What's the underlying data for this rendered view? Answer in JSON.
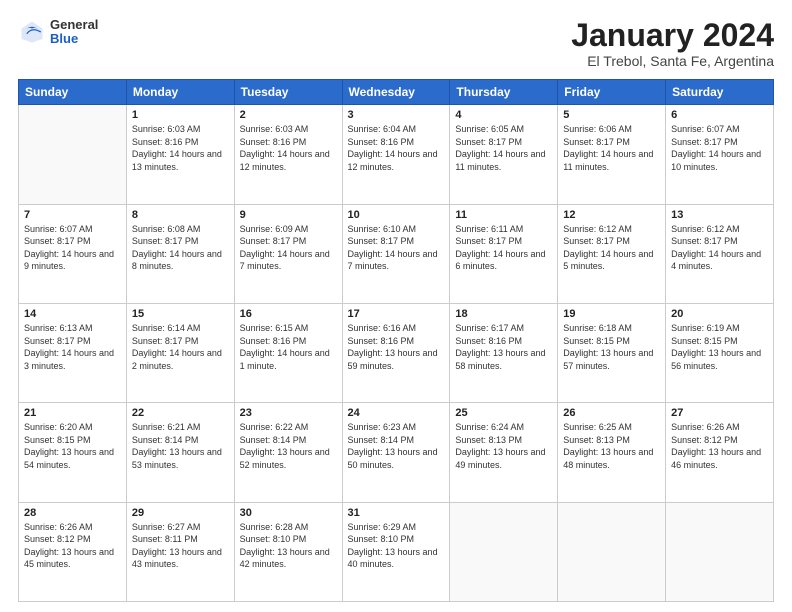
{
  "logo": {
    "general": "General",
    "blue": "Blue"
  },
  "title": "January 2024",
  "subtitle": "El Trebol, Santa Fe, Argentina",
  "header_days": [
    "Sunday",
    "Monday",
    "Tuesday",
    "Wednesday",
    "Thursday",
    "Friday",
    "Saturday"
  ],
  "weeks": [
    [
      {
        "day": "",
        "sunrise": "",
        "sunset": "",
        "daylight": ""
      },
      {
        "day": "1",
        "sunrise": "Sunrise: 6:03 AM",
        "sunset": "Sunset: 8:16 PM",
        "daylight": "Daylight: 14 hours and 13 minutes."
      },
      {
        "day": "2",
        "sunrise": "Sunrise: 6:03 AM",
        "sunset": "Sunset: 8:16 PM",
        "daylight": "Daylight: 14 hours and 12 minutes."
      },
      {
        "day": "3",
        "sunrise": "Sunrise: 6:04 AM",
        "sunset": "Sunset: 8:16 PM",
        "daylight": "Daylight: 14 hours and 12 minutes."
      },
      {
        "day": "4",
        "sunrise": "Sunrise: 6:05 AM",
        "sunset": "Sunset: 8:17 PM",
        "daylight": "Daylight: 14 hours and 11 minutes."
      },
      {
        "day": "5",
        "sunrise": "Sunrise: 6:06 AM",
        "sunset": "Sunset: 8:17 PM",
        "daylight": "Daylight: 14 hours and 11 minutes."
      },
      {
        "day": "6",
        "sunrise": "Sunrise: 6:07 AM",
        "sunset": "Sunset: 8:17 PM",
        "daylight": "Daylight: 14 hours and 10 minutes."
      }
    ],
    [
      {
        "day": "7",
        "sunrise": "Sunrise: 6:07 AM",
        "sunset": "Sunset: 8:17 PM",
        "daylight": "Daylight: 14 hours and 9 minutes."
      },
      {
        "day": "8",
        "sunrise": "Sunrise: 6:08 AM",
        "sunset": "Sunset: 8:17 PM",
        "daylight": "Daylight: 14 hours and 8 minutes."
      },
      {
        "day": "9",
        "sunrise": "Sunrise: 6:09 AM",
        "sunset": "Sunset: 8:17 PM",
        "daylight": "Daylight: 14 hours and 7 minutes."
      },
      {
        "day": "10",
        "sunrise": "Sunrise: 6:10 AM",
        "sunset": "Sunset: 8:17 PM",
        "daylight": "Daylight: 14 hours and 7 minutes."
      },
      {
        "day": "11",
        "sunrise": "Sunrise: 6:11 AM",
        "sunset": "Sunset: 8:17 PM",
        "daylight": "Daylight: 14 hours and 6 minutes."
      },
      {
        "day": "12",
        "sunrise": "Sunrise: 6:12 AM",
        "sunset": "Sunset: 8:17 PM",
        "daylight": "Daylight: 14 hours and 5 minutes."
      },
      {
        "day": "13",
        "sunrise": "Sunrise: 6:12 AM",
        "sunset": "Sunset: 8:17 PM",
        "daylight": "Daylight: 14 hours and 4 minutes."
      }
    ],
    [
      {
        "day": "14",
        "sunrise": "Sunrise: 6:13 AM",
        "sunset": "Sunset: 8:17 PM",
        "daylight": "Daylight: 14 hours and 3 minutes."
      },
      {
        "day": "15",
        "sunrise": "Sunrise: 6:14 AM",
        "sunset": "Sunset: 8:17 PM",
        "daylight": "Daylight: 14 hours and 2 minutes."
      },
      {
        "day": "16",
        "sunrise": "Sunrise: 6:15 AM",
        "sunset": "Sunset: 8:16 PM",
        "daylight": "Daylight: 14 hours and 1 minute."
      },
      {
        "day": "17",
        "sunrise": "Sunrise: 6:16 AM",
        "sunset": "Sunset: 8:16 PM",
        "daylight": "Daylight: 13 hours and 59 minutes."
      },
      {
        "day": "18",
        "sunrise": "Sunrise: 6:17 AM",
        "sunset": "Sunset: 8:16 PM",
        "daylight": "Daylight: 13 hours and 58 minutes."
      },
      {
        "day": "19",
        "sunrise": "Sunrise: 6:18 AM",
        "sunset": "Sunset: 8:15 PM",
        "daylight": "Daylight: 13 hours and 57 minutes."
      },
      {
        "day": "20",
        "sunrise": "Sunrise: 6:19 AM",
        "sunset": "Sunset: 8:15 PM",
        "daylight": "Daylight: 13 hours and 56 minutes."
      }
    ],
    [
      {
        "day": "21",
        "sunrise": "Sunrise: 6:20 AM",
        "sunset": "Sunset: 8:15 PM",
        "daylight": "Daylight: 13 hours and 54 minutes."
      },
      {
        "day": "22",
        "sunrise": "Sunrise: 6:21 AM",
        "sunset": "Sunset: 8:14 PM",
        "daylight": "Daylight: 13 hours and 53 minutes."
      },
      {
        "day": "23",
        "sunrise": "Sunrise: 6:22 AM",
        "sunset": "Sunset: 8:14 PM",
        "daylight": "Daylight: 13 hours and 52 minutes."
      },
      {
        "day": "24",
        "sunrise": "Sunrise: 6:23 AM",
        "sunset": "Sunset: 8:14 PM",
        "daylight": "Daylight: 13 hours and 50 minutes."
      },
      {
        "day": "25",
        "sunrise": "Sunrise: 6:24 AM",
        "sunset": "Sunset: 8:13 PM",
        "daylight": "Daylight: 13 hours and 49 minutes."
      },
      {
        "day": "26",
        "sunrise": "Sunrise: 6:25 AM",
        "sunset": "Sunset: 8:13 PM",
        "daylight": "Daylight: 13 hours and 48 minutes."
      },
      {
        "day": "27",
        "sunrise": "Sunrise: 6:26 AM",
        "sunset": "Sunset: 8:12 PM",
        "daylight": "Daylight: 13 hours and 46 minutes."
      }
    ],
    [
      {
        "day": "28",
        "sunrise": "Sunrise: 6:26 AM",
        "sunset": "Sunset: 8:12 PM",
        "daylight": "Daylight: 13 hours and 45 minutes."
      },
      {
        "day": "29",
        "sunrise": "Sunrise: 6:27 AM",
        "sunset": "Sunset: 8:11 PM",
        "daylight": "Daylight: 13 hours and 43 minutes."
      },
      {
        "day": "30",
        "sunrise": "Sunrise: 6:28 AM",
        "sunset": "Sunset: 8:10 PM",
        "daylight": "Daylight: 13 hours and 42 minutes."
      },
      {
        "day": "31",
        "sunrise": "Sunrise: 6:29 AM",
        "sunset": "Sunset: 8:10 PM",
        "daylight": "Daylight: 13 hours and 40 minutes."
      },
      {
        "day": "",
        "sunrise": "",
        "sunset": "",
        "daylight": ""
      },
      {
        "day": "",
        "sunrise": "",
        "sunset": "",
        "daylight": ""
      },
      {
        "day": "",
        "sunrise": "",
        "sunset": "",
        "daylight": ""
      }
    ]
  ]
}
